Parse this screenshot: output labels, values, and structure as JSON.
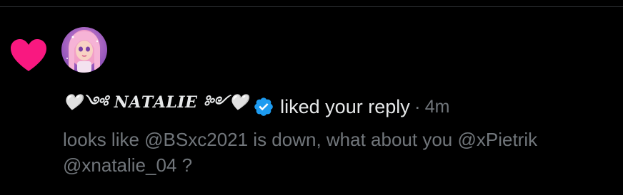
{
  "notification": {
    "type_icon": "heart-icon",
    "type_color": "#f91880",
    "avatar_icon": "avatar-pink-hair-doll",
    "display_name": "🤍༺ 𝑵𝑨𝑻𝑨𝑳𝑰𝑬 ༻🤍",
    "verified_icon": "verified-badge-icon",
    "verified_color": "#1d9bf0",
    "action": "liked your reply",
    "separator": "·",
    "timestamp": "4m",
    "reply_line1": "looks like @BSxc2021 is down, what about you @xPietrik",
    "reply_line2": "@xnatalie_04 ?"
  }
}
